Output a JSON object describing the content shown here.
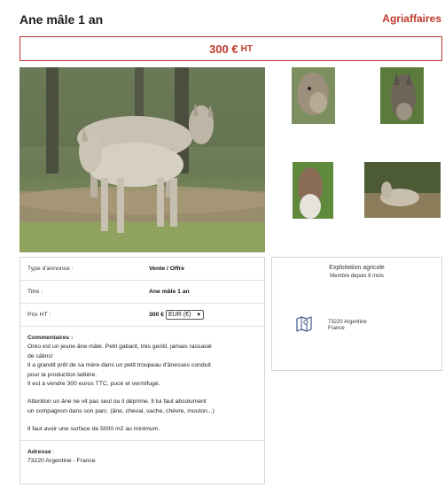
{
  "header": {
    "title": "Ane mâle 1 an",
    "brand": "Agriaffaires"
  },
  "price_banner": {
    "amount": "300 €",
    "tax": "HT"
  },
  "gallery": {
    "main_photo": "donkey-photo",
    "thumbnails": [
      "donkey-thumbnail",
      "donkey-thumbnail",
      "donkey-thumbnail",
      "donkey-thumbnail"
    ]
  },
  "details": {
    "rows": [
      {
        "key": "Type d'annonce :",
        "value": "Vente / Offre"
      },
      {
        "key": "Titre :",
        "value": "Ane mâle 1 an"
      },
      {
        "key": "Prix HT :",
        "value": "300 €"
      }
    ],
    "currency_select": "EUR (€)",
    "comments_label": "Commentaires :",
    "comments": [
      "Oréo est un jeune âne mâle. Petit gabarit, très gentil, jamais rassasié",
      "de câlins!",
      "Il a grandit prêt de sa mère dans un petit troupeau d'ânesses conduit",
      "pour la production laitière.",
      "Il est à vendre 300 euros TTC, pucé et vermifugé.",
      "",
      "Attention un âne ne vit pas seul ou il déprime. Il lui faut absolument",
      "un compagnon dans son parc. (âne, cheval, vache, chèvre, mouton...)",
      "",
      "Il faut avoir une surface de 5000 m2 au minimum."
    ],
    "address_label": "Adresse",
    "address_colon": " :",
    "address": "73220 Argentine - France"
  },
  "seller": {
    "type": "Exploitation agricole",
    "member_since": "Membre depuis 8 mois",
    "map_icon": "map-icon",
    "address_line1": "73220 Argentine",
    "address_line2": "France"
  },
  "colors": {
    "brand_red": "#c0392b",
    "border_grey": "#d4d4d4"
  }
}
